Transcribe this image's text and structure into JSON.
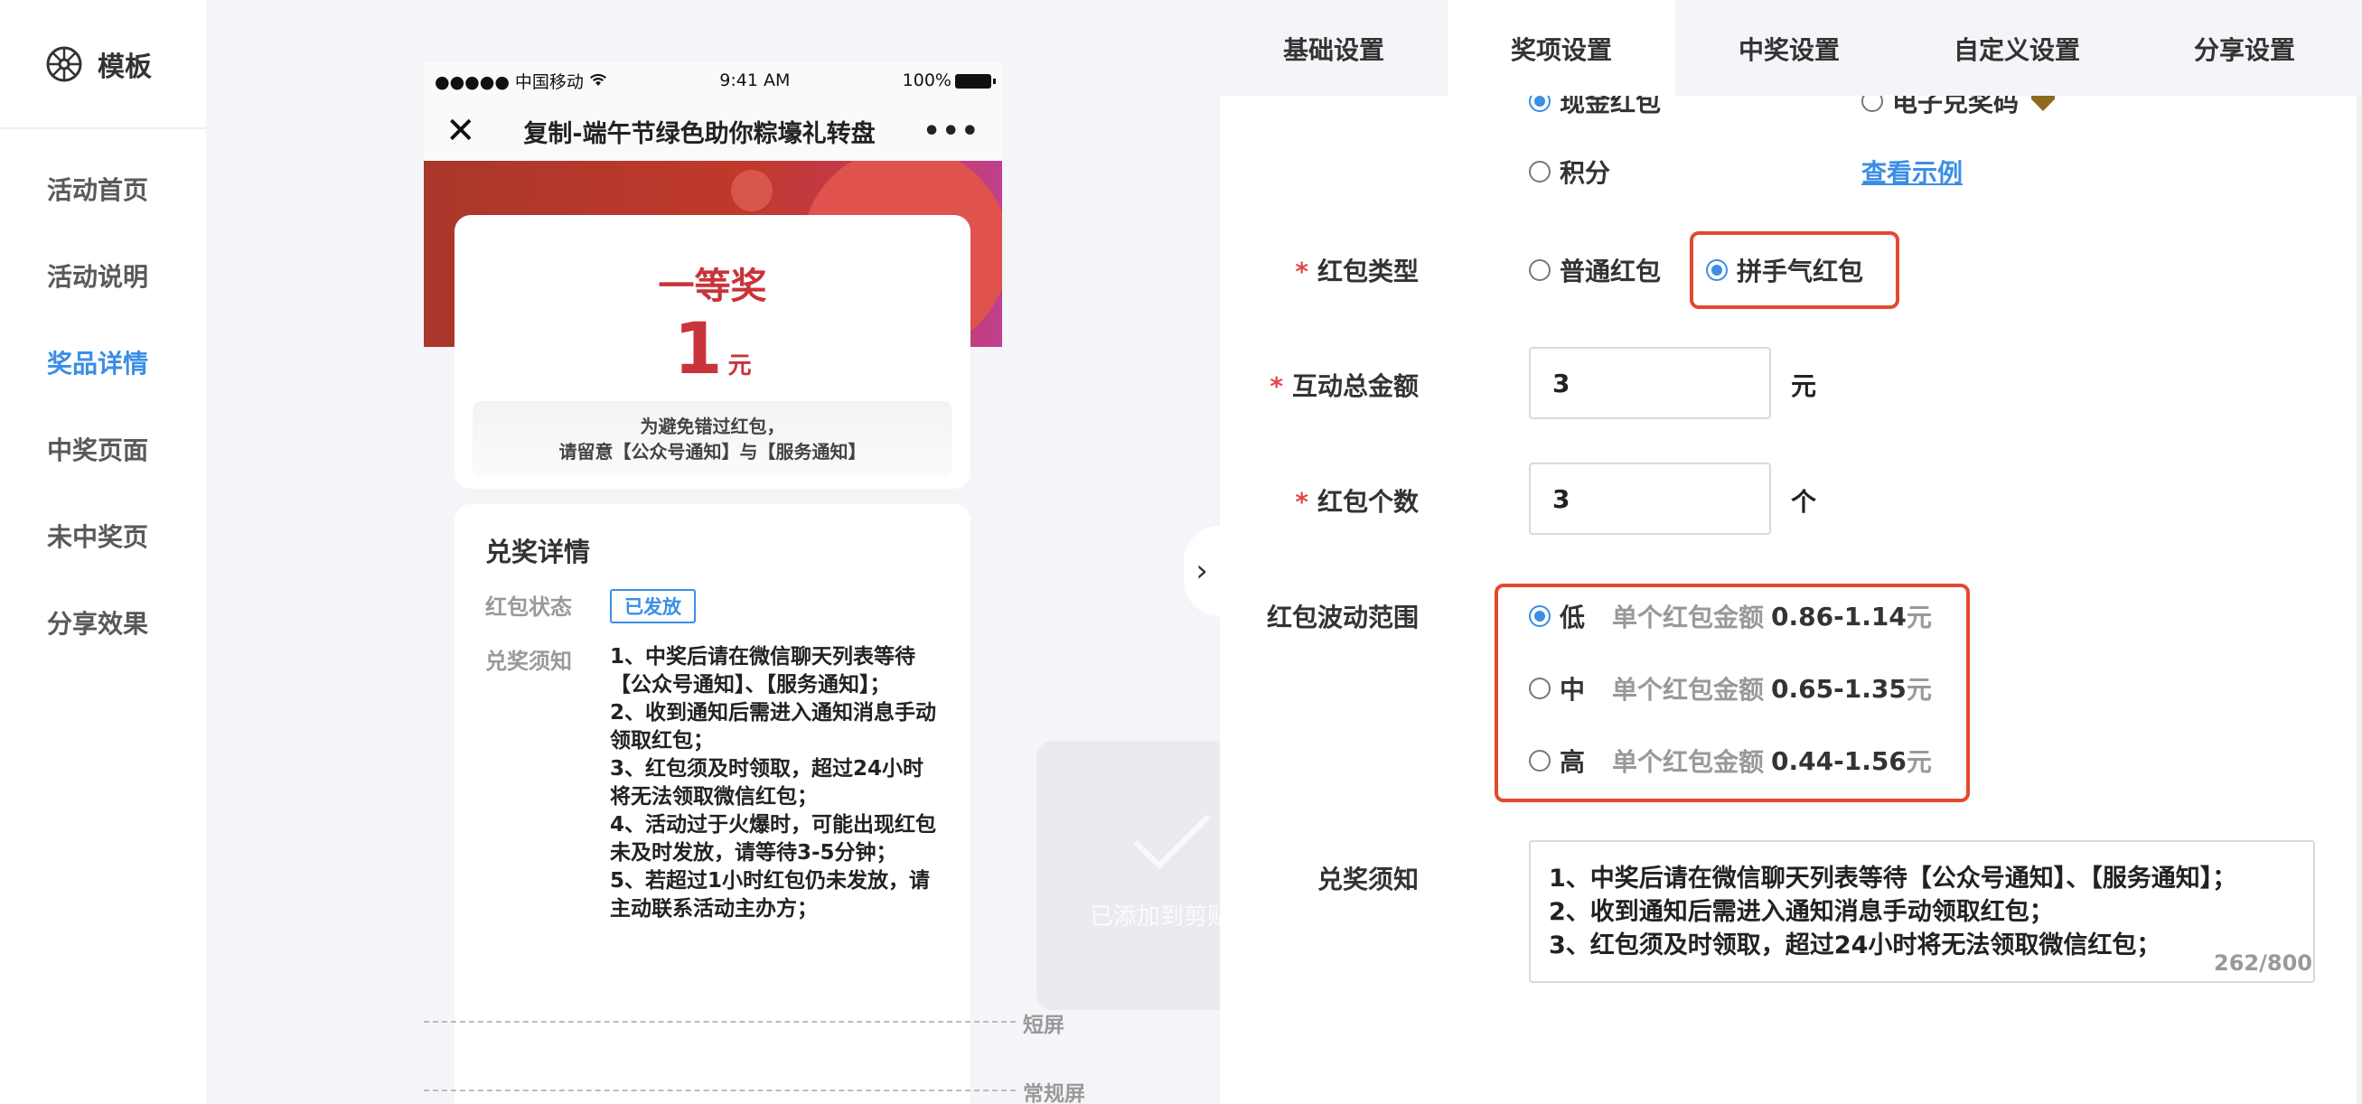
{
  "sidebar": {
    "brand": "模板",
    "items": [
      {
        "label": "活动首页",
        "active": false
      },
      {
        "label": "活动说明",
        "active": false
      },
      {
        "label": "奖品详情",
        "active": true
      },
      {
        "label": "中奖页面",
        "active": false
      },
      {
        "label": "未中奖页",
        "active": false
      },
      {
        "label": "分享效果",
        "active": false
      }
    ]
  },
  "preview": {
    "status_bar": {
      "carrier": "●●●●● 中国移动",
      "time": "9:41 AM",
      "battery": "100%"
    },
    "page_title": "复制-端午节绿色助你粽壕礼转盘",
    "prize": {
      "name": "一等奖",
      "amount": "1",
      "unit": "元",
      "tip": "为避免错过红包，\n请留意【公众号通知】与【服务通知】"
    },
    "detail": {
      "title": "兑奖详情",
      "status_label": "红包状态",
      "status_value": "已发放",
      "notice_label": "兑奖须知",
      "notice_text": "1、中奖后请在微信聊天列表等待【公众号通知】、【服务通知】；\n2、收到通知后需进入通知消息手动领取红包；\n3、红包须及时领取，超过24小时将无法领取微信红包；\n4、活动过于火爆时，可能出现红包未及时发放，请等待3-5分钟；\n5、若超过1小时红包仍未发放，请主动联系活动主办方；"
    },
    "guides": {
      "short": "短屏",
      "regular": "常规屏"
    }
  },
  "toast": {
    "text": "已添加到剪贴板"
  },
  "tabs": [
    {
      "label": "基础设置",
      "active": false
    },
    {
      "label": "奖项设置",
      "active": true
    },
    {
      "label": "中奖设置",
      "active": false
    },
    {
      "label": "自定义设置",
      "active": false
    },
    {
      "label": "分享设置",
      "active": false
    }
  ],
  "form": {
    "prize_type_options": [
      {
        "label": "现金红包",
        "checked": true
      },
      {
        "label": "电子兑奖码",
        "checked": false
      },
      {
        "label": "积分",
        "checked": false
      }
    ],
    "view_example_link": "查看示例",
    "redpacket_type": {
      "label": "红包类型",
      "options": [
        {
          "label": "普通红包",
          "checked": false
        },
        {
          "label": "拼手气红包",
          "checked": true
        }
      ]
    },
    "total_amount": {
      "label": "互动总金额",
      "value": "3",
      "unit": "元"
    },
    "count": {
      "label": "红包个数",
      "value": "3",
      "unit": "个"
    },
    "fluctuation": {
      "label": "红包波动范围",
      "desc": "单个红包金额",
      "unit": "元",
      "options": [
        {
          "label": "低",
          "range": "0.86-1.14",
          "checked": true
        },
        {
          "label": "中",
          "range": "0.65-1.35",
          "checked": false
        },
        {
          "label": "高",
          "range": "0.44-1.56",
          "checked": false
        }
      ]
    },
    "notice": {
      "label": "兑奖须知",
      "text": "1、中奖后请在微信聊天列表等待【公众号通知】、【服务通知】；\n2、收到通知后需进入通知消息手动领取红包；\n3、红包须及时领取，超过24小时将无法领取微信红包；",
      "counter": "262/800"
    }
  },
  "colors": {
    "accent": "#3a8ee6",
    "highlight": "#e5482f",
    "prize_red": "#c8343a",
    "required": "#e5484d"
  }
}
